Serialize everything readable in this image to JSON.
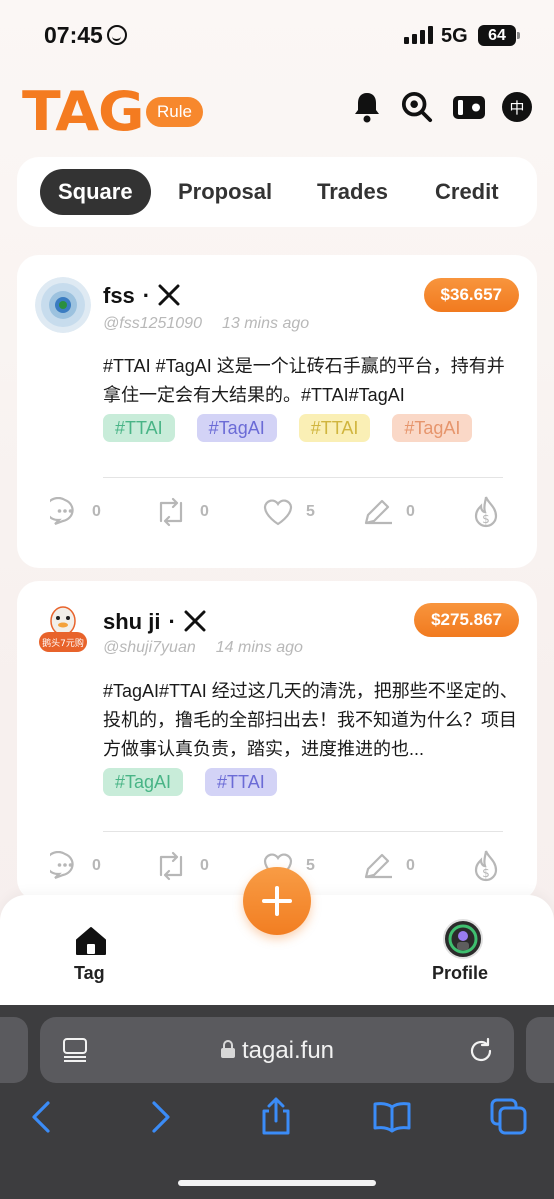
{
  "status_bar": {
    "time": "07:45",
    "network": "5G",
    "battery": "64"
  },
  "header": {
    "logo": "TAG",
    "rule_label": "Rule",
    "lang_label": "中"
  },
  "tabs": [
    {
      "label": "Square",
      "active": true
    },
    {
      "label": "Proposal",
      "active": false
    },
    {
      "label": "Trades",
      "active": false
    },
    {
      "label": "Credit",
      "active": false
    }
  ],
  "posts": [
    {
      "name": "fss",
      "handle": "@fss1251090",
      "time_ago": "13 mins ago",
      "price": "$36.657",
      "content": "#TTAI #TagAI 这是一个让砖石手赢的平台，持有并拿住一定会有大结果的。#TTAI#TagAI",
      "tags": [
        "#TTAI",
        "#TagAI",
        "#TTAI",
        "#TagAI"
      ],
      "comments": "0",
      "retweets": "0",
      "likes": "5",
      "edits": "0"
    },
    {
      "name": "shu ji",
      "handle": "@shuji7yuan",
      "time_ago": "14 mins ago",
      "price": "$275.867",
      "content": "#TagAI#TTAI 经过这几天的清洗，把那些不坚定的、投机的，撸毛的全部扫出去！我不知道为什么？项目方做事认真负责，踏实，进度推进的也...",
      "tags": [
        "#TagAI",
        "#TTAI"
      ],
      "comments": "0",
      "retweets": "0",
      "likes": "5",
      "edits": "0"
    }
  ],
  "bottom_nav": {
    "tag_label": "Tag",
    "profile_label": "Profile"
  },
  "browser": {
    "url": "tagai.fun"
  },
  "colors": {
    "accent": "#f47b20",
    "tab_active": "#333333"
  }
}
